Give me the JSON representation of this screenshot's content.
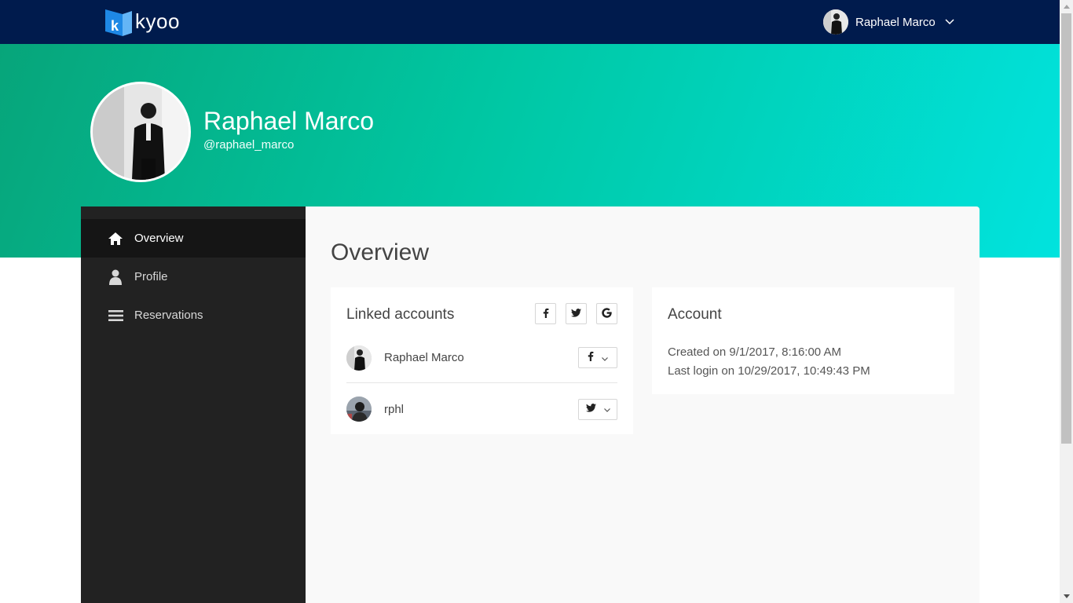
{
  "brand": {
    "name": "kyoo",
    "mark_color": "#1e88e5"
  },
  "header": {
    "user_name": "Raphael Marco"
  },
  "hero": {
    "name": "Raphael Marco",
    "handle": "@raphael_marco"
  },
  "sidebar": {
    "items": [
      {
        "label": "Overview",
        "icon": "home-icon",
        "active": true
      },
      {
        "label": "Profile",
        "icon": "user-icon",
        "active": false
      },
      {
        "label": "Reservations",
        "icon": "list-icon",
        "active": false
      }
    ]
  },
  "main": {
    "title": "Overview",
    "linked": {
      "title": "Linked accounts",
      "add_buttons": [
        "facebook-icon",
        "twitter-icon",
        "google-icon"
      ],
      "accounts": [
        {
          "name": "Raphael Marco",
          "provider": "facebook-icon"
        },
        {
          "name": "rphl",
          "provider": "twitter-icon"
        }
      ]
    },
    "account": {
      "title": "Account",
      "created": "Created on 9/1/2017, 8:16:00 AM",
      "last_login": "Last login on 10/29/2017, 10:49:43 PM"
    }
  },
  "colors": {
    "topbar": "#001b4d",
    "hero_start": "#07a57a",
    "hero_end": "#01e3de",
    "sidebar": "#222222"
  }
}
